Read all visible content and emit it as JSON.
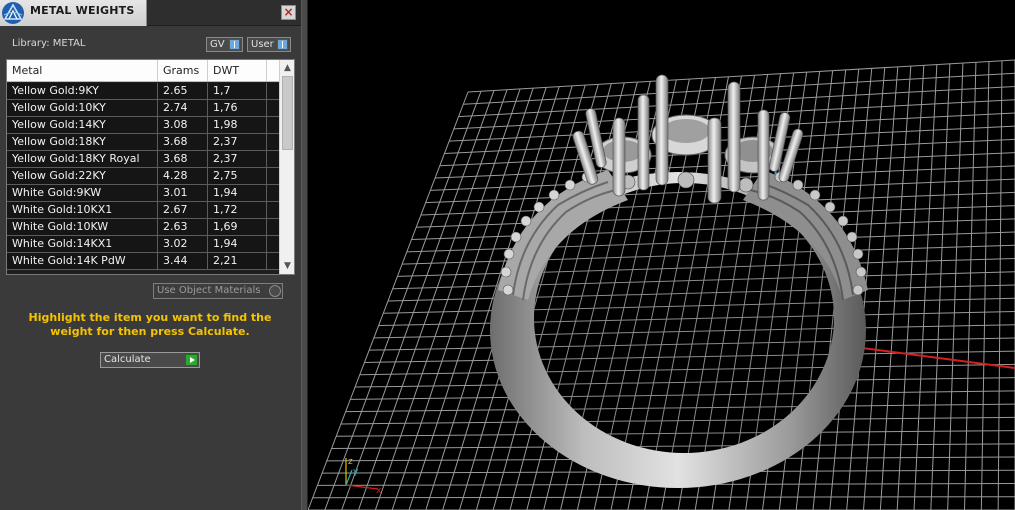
{
  "panel": {
    "title": "METAL WEIGHTS",
    "close_symbol": "×",
    "library_label": "Library: METAL",
    "toggles": [
      {
        "label": "GV",
        "icon": "info-icon"
      },
      {
        "label": "User",
        "icon": "info-icon"
      }
    ]
  },
  "table": {
    "columns": [
      "Metal",
      "Grams",
      "DWT"
    ],
    "rows": [
      {
        "metal": "Yellow Gold:9KY",
        "grams": "2.65",
        "dwt": "1,7"
      },
      {
        "metal": "Yellow Gold:10KY",
        "grams": "2.74",
        "dwt": "1,76"
      },
      {
        "metal": "Yellow Gold:14KY",
        "grams": "3.08",
        "dwt": "1,98"
      },
      {
        "metal": "Yellow Gold:18KY",
        "grams": "3.68",
        "dwt": "2,37"
      },
      {
        "metal": "Yellow Gold:18KY Royal",
        "grams": "3.68",
        "dwt": "2,37"
      },
      {
        "metal": "Yellow Gold:22KY",
        "grams": "4.28",
        "dwt": "2,75"
      },
      {
        "metal": "White Gold:9KW",
        "grams": "3.01",
        "dwt": "1,94"
      },
      {
        "metal": "White Gold:10KX1",
        "grams": "2.67",
        "dwt": "1,72"
      },
      {
        "metal": "White Gold:10KW",
        "grams": "2.63",
        "dwt": "1,69"
      },
      {
        "metal": "White Gold:14KX1",
        "grams": "3.02",
        "dwt": "1,94"
      },
      {
        "metal": "White Gold:14K PdW",
        "grams": "3.44",
        "dwt": "2,21"
      }
    ]
  },
  "use_object_materials": "Use Object Materials",
  "hint": "Highlight the item you want to find the weight for then press Calculate.",
  "calculate_label": "Calculate",
  "axis_gizmo": {
    "z": "z",
    "y": "y",
    "x": "x"
  },
  "colors": {
    "hint": "#f5c400",
    "accent_blue": "#6fa8d8",
    "go_green": "#2ea82e"
  }
}
